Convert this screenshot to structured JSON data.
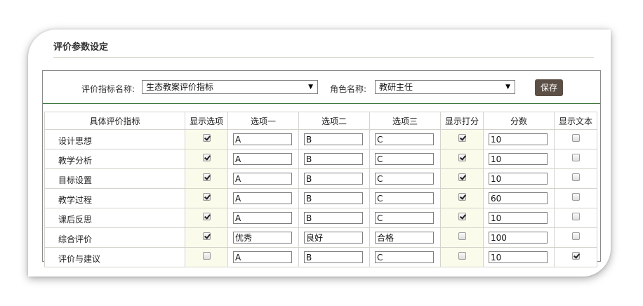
{
  "page": {
    "title": "评价参数设定"
  },
  "toolbar": {
    "indicator_label": "评价指标名称:",
    "indicator_value": "生态教案评价指标",
    "role_label": "角色名称:",
    "role_value": "教研主任",
    "save_label": "保存"
  },
  "table": {
    "headers": [
      "具体评价指标",
      "显示选项",
      "选项一",
      "选项二",
      "选项三",
      "显示打分",
      "分数",
      "显示文本"
    ],
    "rows": [
      {
        "indicator": "设计思想",
        "show_options": true,
        "opt1": "A",
        "opt2": "B",
        "opt3": "C",
        "show_score": true,
        "score": "10",
        "show_text": false
      },
      {
        "indicator": "教学分析",
        "show_options": true,
        "opt1": "A",
        "opt2": "B",
        "opt3": "C",
        "show_score": true,
        "score": "10",
        "show_text": false
      },
      {
        "indicator": "目标设置",
        "show_options": true,
        "opt1": "A",
        "opt2": "B",
        "opt3": "C",
        "show_score": true,
        "score": "10",
        "show_text": false
      },
      {
        "indicator": "教学过程",
        "show_options": true,
        "opt1": "A",
        "opt2": "B",
        "opt3": "C",
        "show_score": true,
        "score": "60",
        "show_text": false
      },
      {
        "indicator": "课后反思",
        "show_options": true,
        "opt1": "A",
        "opt2": "B",
        "opt3": "C",
        "show_score": true,
        "score": "10",
        "show_text": false
      },
      {
        "indicator": "综合评价",
        "show_options": true,
        "opt1": "优秀",
        "opt2": "良好",
        "opt3": "合格",
        "show_score": false,
        "score": "100",
        "show_text": false
      },
      {
        "indicator": "评价与建议",
        "show_options": false,
        "opt1": "A",
        "opt2": "B",
        "opt3": "C",
        "show_score": false,
        "score": "10",
        "show_text": true
      }
    ]
  },
  "colors": {
    "save_button_bg": "#5c4f45",
    "toolbar_rule": "#3e7a3e",
    "checkbox_col_bg": "#fbfbeb"
  }
}
